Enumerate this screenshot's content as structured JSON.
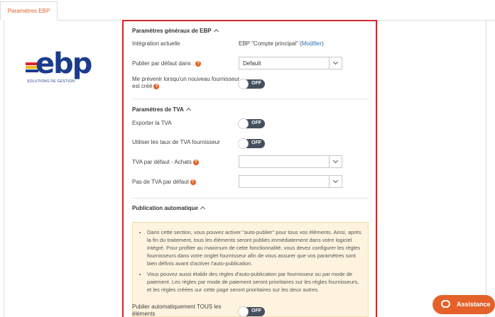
{
  "tab": {
    "label": "Paramètres EBP"
  },
  "logo": {
    "brand": "ebp",
    "tagline": "SOLUTIONS DE GESTION"
  },
  "general": {
    "title": "Paramètres généraux de EBP",
    "integration_label": "Intégration actuelle",
    "integration_value": "EBP \"Compte principal\" (",
    "integration_link": "Modifier",
    "integration_close": ")",
    "publish_label": "Publier par défaut dans :",
    "publish_value": "Default",
    "notify_label_1": "Me prévenir lorsqu'un nouveau fournisseur",
    "notify_label_2": "est créé",
    "notify_toggle": "OFF"
  },
  "tva": {
    "title": "Paramètres de TVA",
    "export_label": "Exporter la TVA",
    "export_toggle": "OFF",
    "use_rates_label": "Utiliser les taux de TVA fournisseur",
    "use_rates_toggle": "OFF",
    "default_purchase_label": "TVA par défaut - Achats",
    "default_purchase_value": "",
    "no_default_label": "Pas de TVA par défaut",
    "no_default_value": ""
  },
  "auto": {
    "title": "Publication automatique",
    "notice_1": "Dans cette section, vous pouvez activer \"auto-publier\" pour tous vos éléments. Ainsi, après la fin du traitement, tous les éléments seront publiés immédiatement dans votre logiciel intégré. Pour profiter au maximum de cette fonctionnalité, vous devez configurer les règles fournisseurs dans votre onglet fournisseur afin de vous assurer que vos paramètres sont bien définis avant d'activer l'auto-publication.",
    "notice_2": "Vous pouvez aussi établir des règles d'auto-publication par fournisseur ou par mode de paiement. Les règles par mode de paiement seront prioritaires sur les règles fournisseurs, et les règles créées sur cette page seront prioritaires sur les deux autres.",
    "all_label_1": "Publier automatiquement TOUS les",
    "all_label_2": "éléments",
    "all_toggle": "OFF"
  },
  "assist": {
    "label": "Assistance"
  },
  "colors": {
    "accent": "#e4622a",
    "frame": "#d3262d",
    "toggle_off": "#44505e",
    "brand_blue": "#1a3b8c"
  }
}
